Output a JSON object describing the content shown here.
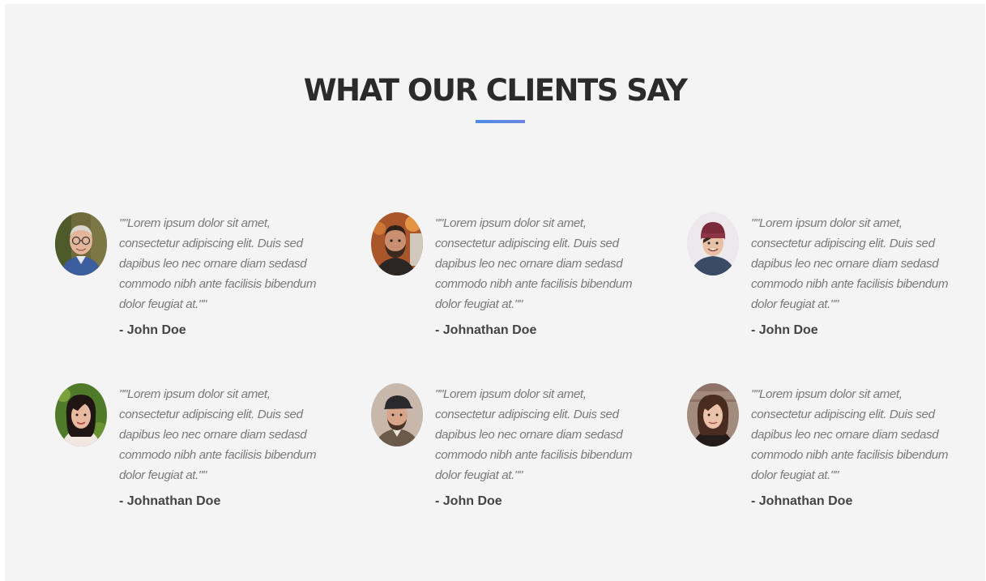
{
  "section": {
    "title": "WHAT OUR CLIENTS SAY",
    "accent_color": "#4b8de6"
  },
  "testimonials": [
    {
      "quote": "\"\"Lorem ipsum dolor sit amet, consectetur adipiscing elit. Duis sed dapibus leo nec ornare diam sedasd commodo nibh ante facilisis bibendum dolor feugiat at.\"\"",
      "author": "- John Doe",
      "avatar_icon": "avatar-older-man-glasses"
    },
    {
      "quote": "\"\"Lorem ipsum dolor sit amet, consectetur adipiscing elit. Duis sed dapibus leo nec ornare diam sedasd commodo nibh ante facilisis bibendum dolor feugiat at.\"\"",
      "author": "- Johnathan Doe",
      "avatar_icon": "avatar-bearded-man"
    },
    {
      "quote": "\"\"Lorem ipsum dolor sit amet, consectetur adipiscing elit. Duis sed dapibus leo nec ornare diam sedasd commodo nibh ante facilisis bibendum dolor feugiat at.\"\"",
      "author": "- John Doe",
      "avatar_icon": "avatar-young-man-beanie"
    },
    {
      "quote": "\"\"Lorem ipsum dolor sit amet, consectetur adipiscing elit. Duis sed dapibus leo nec ornare diam sedasd commodo nibh ante facilisis bibendum dolor feugiat at.\"\"",
      "author": "- Johnathan Doe",
      "avatar_icon": "avatar-woman-dark-hair"
    },
    {
      "quote": "\"\"Lorem ipsum dolor sit amet, consectetur adipiscing elit. Duis sed dapibus leo nec ornare diam sedasd commodo nibh ante facilisis bibendum dolor feugiat at.\"\"",
      "author": "- John Doe",
      "avatar_icon": "avatar-man-flat-cap"
    },
    {
      "quote": "\"\"Lorem ipsum dolor sit amet, consectetur adipiscing elit. Duis sed dapibus leo nec ornare diam sedasd commodo nibh ante facilisis bibendum dolor feugiat at.\"\"",
      "author": "- Johnathan Doe",
      "avatar_icon": "avatar-woman-brown-hair"
    }
  ]
}
